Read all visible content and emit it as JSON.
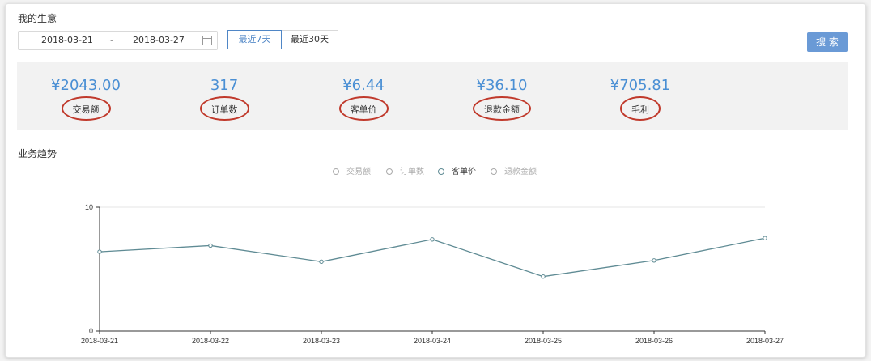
{
  "header": {
    "title": "我的生意"
  },
  "filters": {
    "start_date": "2018-03-21",
    "separator": "~",
    "end_date": "2018-03-27",
    "range_options": [
      "最近7天",
      "最近30天"
    ],
    "active_range": "最近7天",
    "search_label": "搜 索"
  },
  "stats": [
    {
      "value": "¥2043.00",
      "label": "交易额"
    },
    {
      "value": "317",
      "label": "订单数"
    },
    {
      "value": "¥6.44",
      "label": "客单价"
    },
    {
      "value": "¥36.10",
      "label": "退款金额"
    },
    {
      "value": "¥705.81",
      "label": "毛利"
    }
  ],
  "trend": {
    "title": "业务趋势"
  },
  "colors": {
    "accent": "#4a8fd4",
    "button": "#6a9ad6",
    "series_line": "#5f8b94",
    "annotation_ring": "#c0392b"
  },
  "chart_data": {
    "type": "line",
    "legend": [
      {
        "name": "交易额",
        "active": false
      },
      {
        "name": "订单数",
        "active": false
      },
      {
        "name": "客单价",
        "active": true
      },
      {
        "name": "退款金额",
        "active": false
      }
    ],
    "x": [
      "2018-03-21",
      "2018-03-22",
      "2018-03-23",
      "2018-03-24",
      "2018-03-25",
      "2018-03-26",
      "2018-03-27"
    ],
    "series": [
      {
        "name": "客单价",
        "values": [
          6.4,
          6.9,
          5.6,
          7.4,
          4.4,
          5.7,
          7.5
        ]
      }
    ],
    "ylim": [
      0,
      10
    ],
    "yticks": [
      "0",
      "10"
    ],
    "grid": true,
    "legend_position": "top-center"
  }
}
